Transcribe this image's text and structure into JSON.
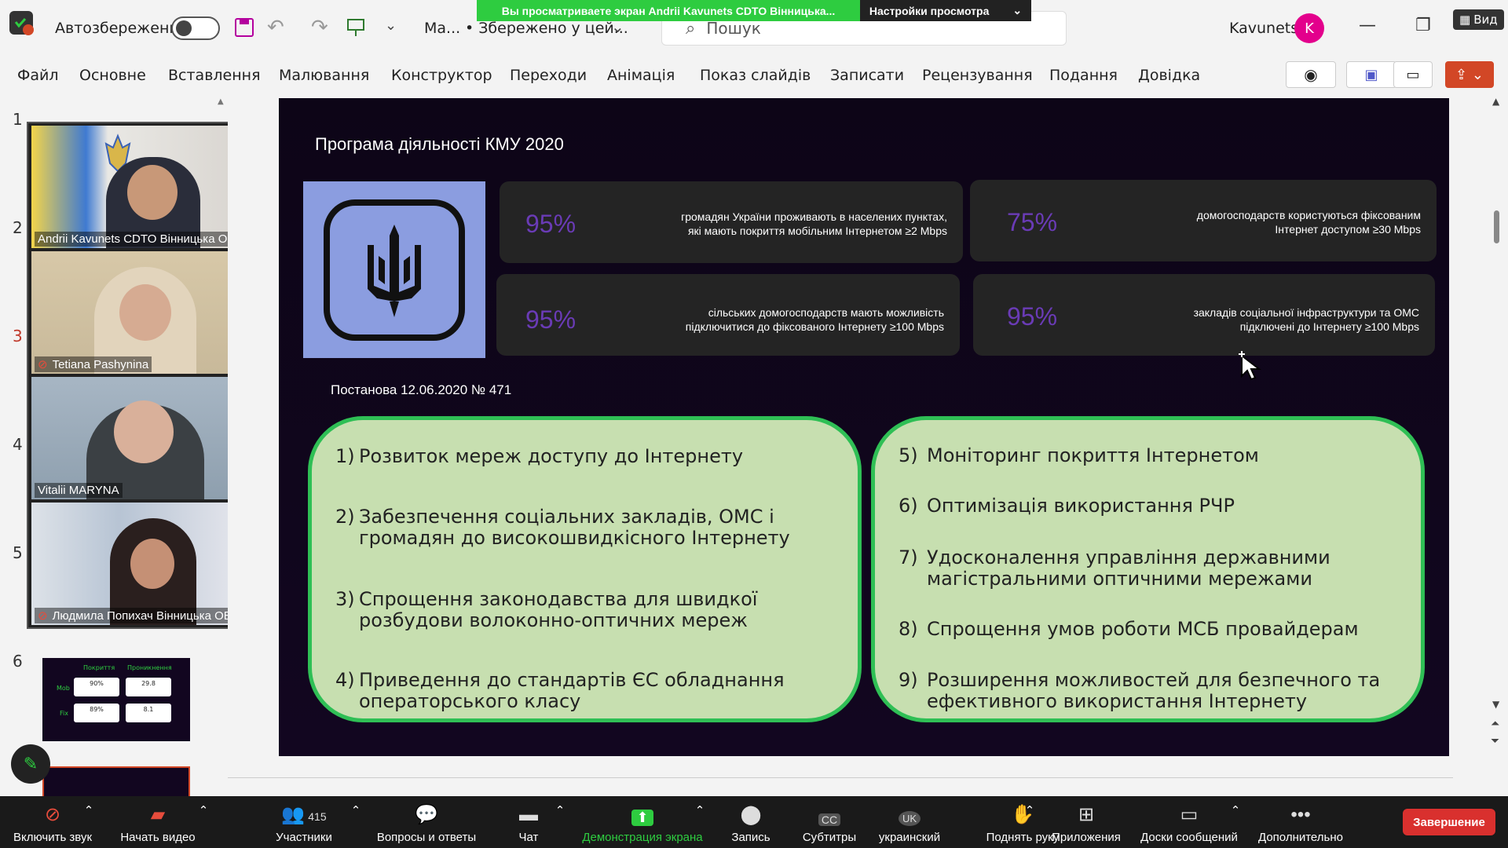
{
  "titlebar": {
    "autosave_label": "Автозбереження",
    "file_name": "Ма...",
    "save_status": "• Збережено у цей...",
    "search_placeholder": "Пошук",
    "user_name": "Kavunets",
    "user_initial": "K",
    "view_label": "Вид"
  },
  "share_banner": {
    "message": "Вы просматриваете экран Andrii Kavunets CDTO Вінницька...",
    "settings_label": "Настройки просмотра"
  },
  "ribbon": {
    "tabs": [
      "Файл",
      "Основне",
      "Вставлення",
      "Малювання",
      "Конструктор",
      "Переходи",
      "Анімація",
      "Показ слайдів",
      "Записати",
      "Рецензування",
      "Подання",
      "Довідка"
    ]
  },
  "thumbnails": {
    "numbers": [
      "1",
      "2",
      "3",
      "4",
      "5",
      "6"
    ],
    "slide6": {
      "col1": "Покриття",
      "col2": "Проникнення",
      "row1": "Mob",
      "row2": "Fix",
      "v1": "90%",
      "v2": "29.8",
      "v3": "89%",
      "v4": "8.1"
    }
  },
  "participants": [
    {
      "name": "Andrii Kavunets CDTO Вінницька ОВА",
      "muted": false
    },
    {
      "name": "Tetiana  Pashynina",
      "muted": true
    },
    {
      "name": "Vitalii MARYNA",
      "muted": false
    },
    {
      "name": "Людмила Попихач Вінницька ОВА",
      "muted": true
    }
  ],
  "slide": {
    "title": "Програма діяльності КМУ 2020",
    "stats": [
      {
        "pct": "95%",
        "line1": "громадян України проживають в населених пунктах,",
        "line2": "які мають покриття мобільним Інтернетом ≥2 Mbps"
      },
      {
        "pct": "75%",
        "line1": "домогосподарств користуються фіксованим",
        "line2": "Інтернет доступом ≥30 Mbps"
      },
      {
        "pct": "95%",
        "line1": "сільських домогосподарств мають можливість",
        "line2": "підключитися до фіксованого Інтернету  ≥100 Mbps"
      },
      {
        "pct": "95%",
        "line1": "закладів соціальної інфраструктури та ОМС",
        "line2": "підключені до Інтернету  ≥100 Mbps"
      }
    ],
    "decree": "Постанова 12.06.2020 № 471",
    "left_items": [
      {
        "n": "1)",
        "l1": "Розвиток мереж доступу до Інтернету",
        "l2": ""
      },
      {
        "n": "2)",
        "l1": "Забезпечення соціальних закладів, ОМС і",
        "l2": "громадян до високошвидкісного Інтернету"
      },
      {
        "n": "3)",
        "l1": "Спрощення законодавства для швидкої",
        "l2": "розбудови волоконно-оптичних мереж"
      },
      {
        "n": "4)",
        "l1": "Приведення до стандартів ЄС обладнання",
        "l2": "операторського класу"
      }
    ],
    "right_items": [
      {
        "n": "5)",
        "l1": "Моніторинг покриття Інтернетом",
        "l2": ""
      },
      {
        "n": "6)",
        "l1": "Оптимізація використання РЧР",
        "l2": ""
      },
      {
        "n": "7)",
        "l1": "Удосконалення управління державними",
        "l2": "магістральними оптичними мережами"
      },
      {
        "n": "8)",
        "l1": "Спрощення умов роботи МСБ провайдерам",
        "l2": ""
      },
      {
        "n": "9)",
        "l1": "Розширення можливостей для безпечного та",
        "l2": "ефективного використання Інтернету"
      }
    ]
  },
  "zoom_toolbar": {
    "unmute": "Включить звук",
    "start_video": "Начать видео",
    "participants": "Участники",
    "participants_count": "415",
    "qa": "Вопросы и ответы",
    "chat": "Чат",
    "share_screen": "Демонстрация экрана",
    "record": "Запись",
    "subtitles": "Субтитры",
    "language": "украинский",
    "language_code": "UK",
    "raise_hand": "Поднять руку",
    "apps": "Приложения",
    "whiteboards": "Доски сообщений",
    "more": "Дополнительно",
    "end": "Завершение"
  },
  "colors": {
    "accent_green": "#2fbf55",
    "panel_green": "#c7dfb0",
    "stat_purple": "#6a3bb6",
    "end_red": "#d9302e"
  }
}
